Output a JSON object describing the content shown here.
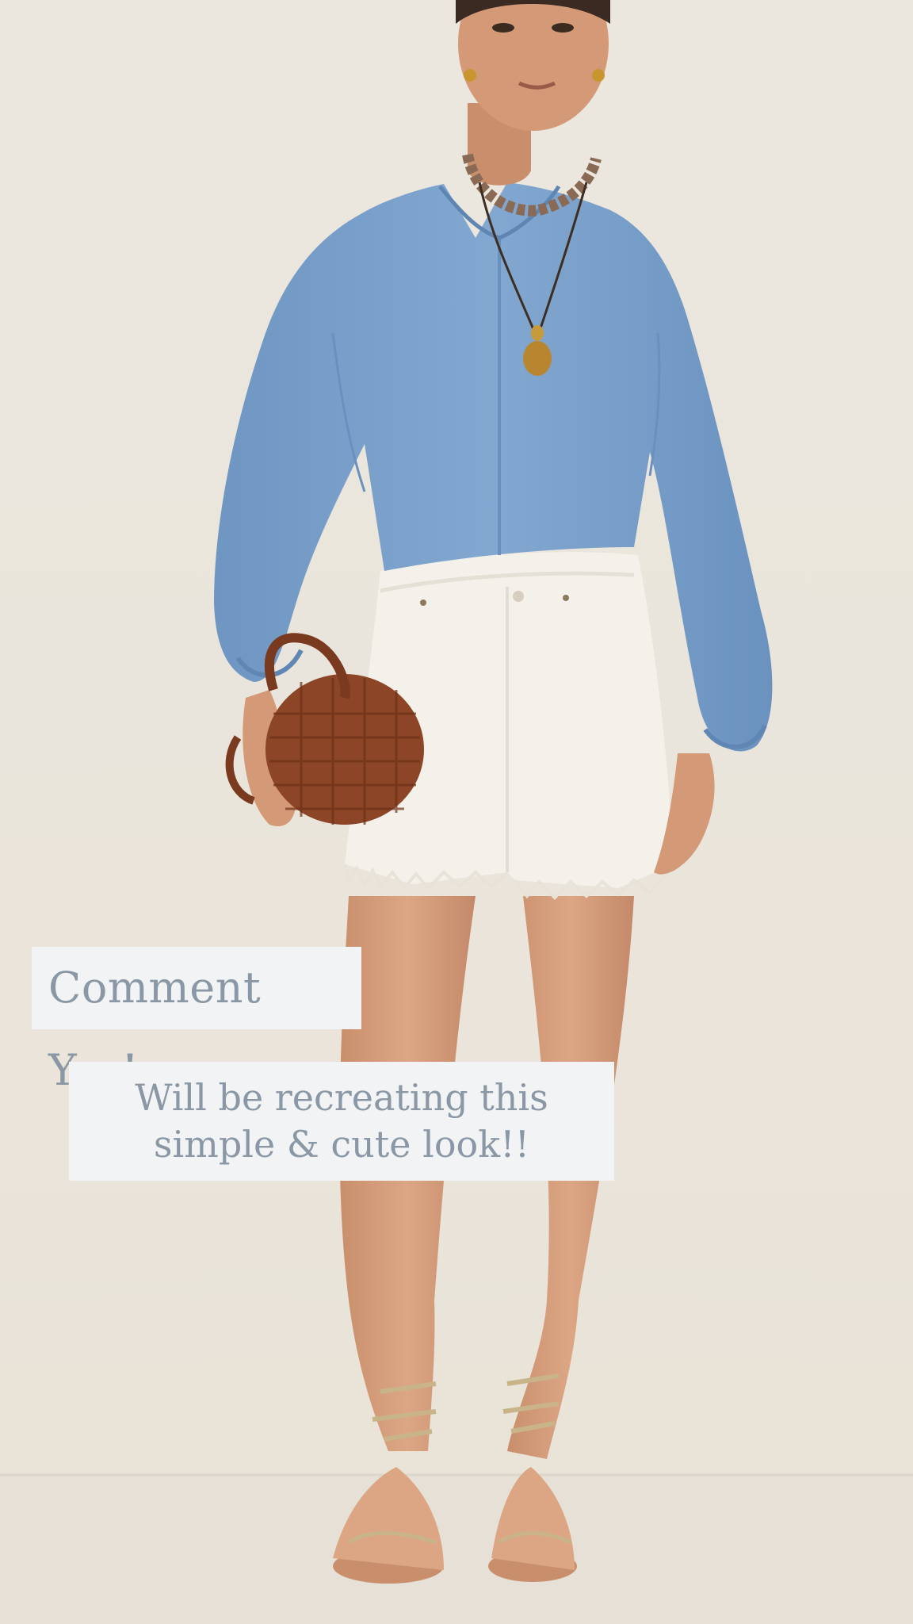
{
  "overlay": {
    "comment_text": "Comment Yes!",
    "description_text": "Will be recreating this simple & cute look!!"
  },
  "scene": {
    "background_color": "#ebe6dd",
    "floor_color": "#e6e0d6",
    "caption_bg_color": "#f2f3f5",
    "caption_text_color": "#8a97a5",
    "blouse_color": "#7aa1cc",
    "shorts_color": "#f4f1ea",
    "bag_color": "#8c4526",
    "skin_color": "#d9a07c"
  }
}
